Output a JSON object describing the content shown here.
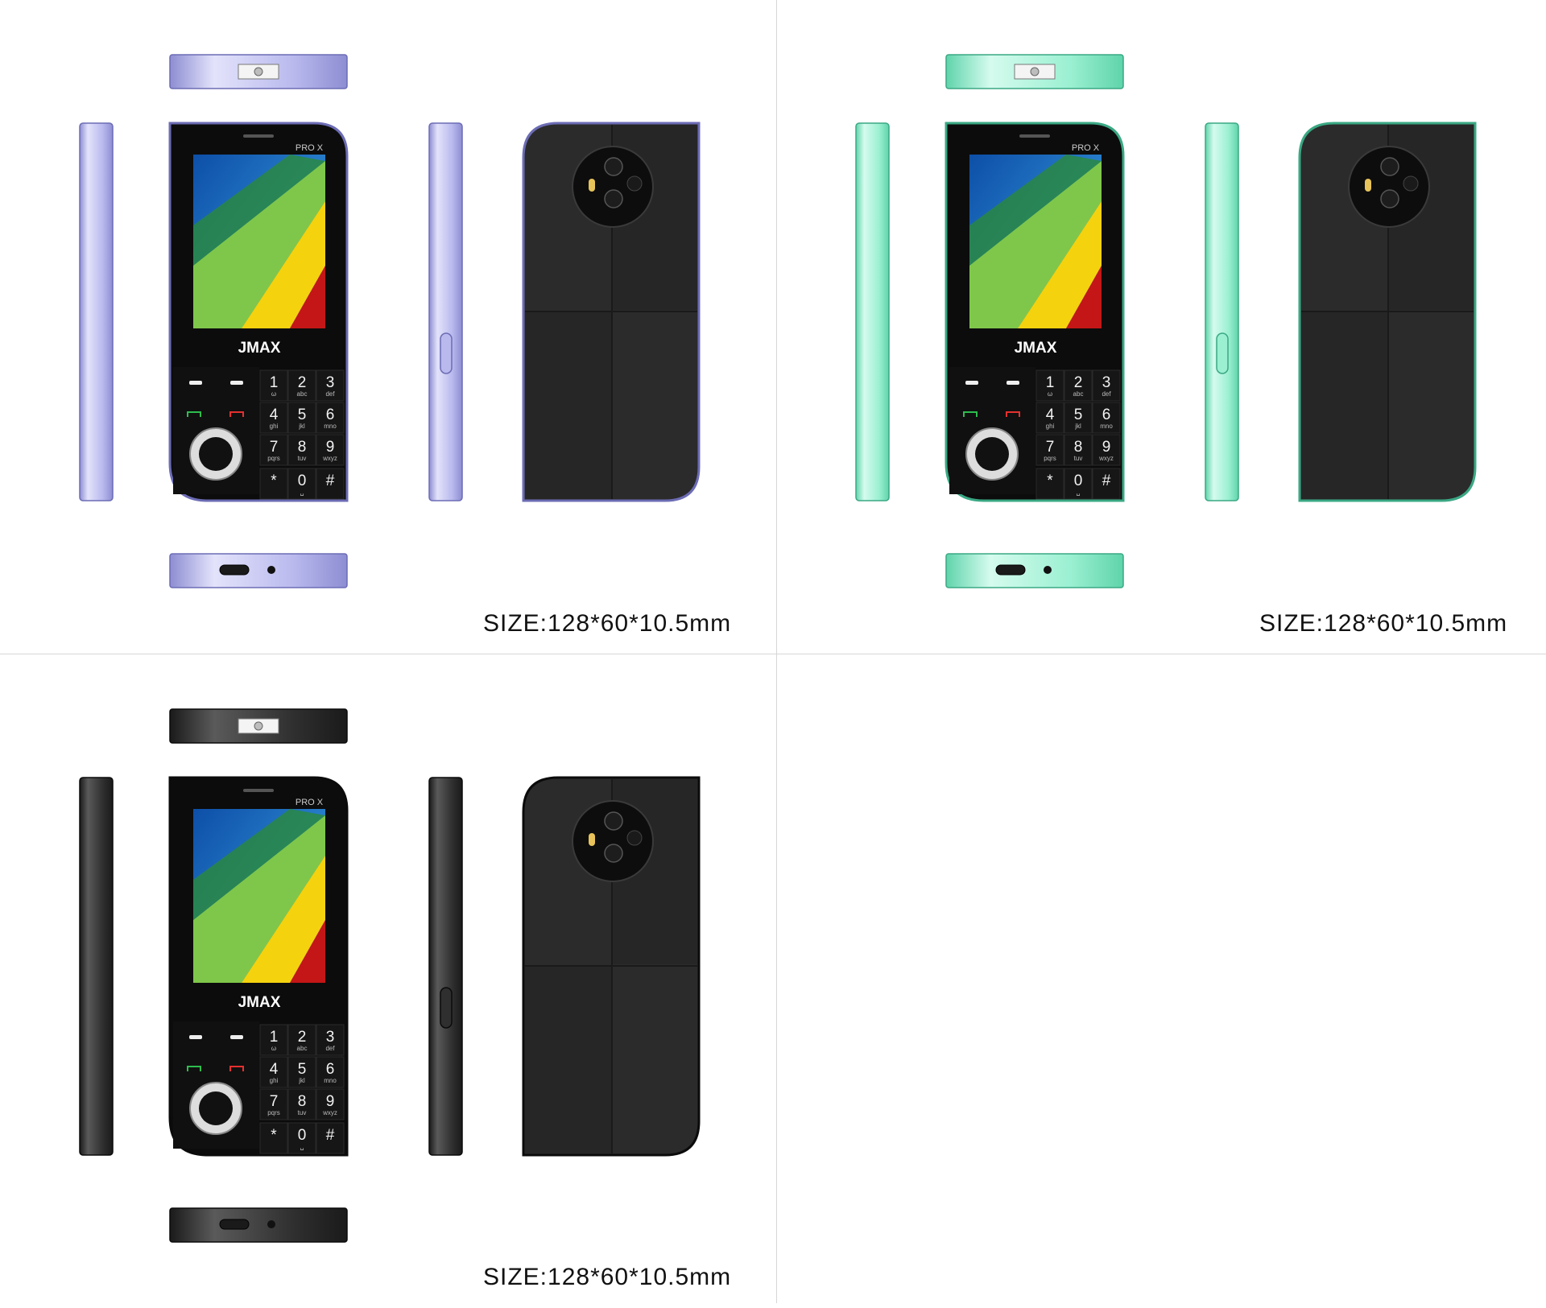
{
  "variants": [
    {
      "name": "lavender",
      "colors": {
        "light": "#e3e3fb",
        "main": "#b9b9ee",
        "dark": "#8d8dd2",
        "edge": "#6c6cb5"
      },
      "size_label": "SIZE:128*60*10.5mm"
    },
    {
      "name": "mint",
      "colors": {
        "light": "#d5fbee",
        "main": "#9bf0d2",
        "dark": "#5fd4ab",
        "edge": "#3aa884"
      },
      "size_label": "SIZE:128*60*10.5mm"
    },
    {
      "name": "black",
      "colors": {
        "light": "#5a5a5a",
        "main": "#2f2f2f",
        "dark": "#1a1a1a",
        "edge": "#0b0b0b"
      },
      "size_label": "SIZE:128*60*10.5mm"
    }
  ],
  "phone": {
    "model": "PRO X",
    "brand": "JMAX",
    "keys": [
      {
        "digit": "1",
        "sub": "ω"
      },
      {
        "digit": "2",
        "sub": "abc"
      },
      {
        "digit": "3",
        "sub": "def"
      },
      {
        "digit": "4",
        "sub": "ghi"
      },
      {
        "digit": "5",
        "sub": "jkl"
      },
      {
        "digit": "6",
        "sub": "mno"
      },
      {
        "digit": "7",
        "sub": "pqrs"
      },
      {
        "digit": "8",
        "sub": "tuv"
      },
      {
        "digit": "9",
        "sub": "wxyz"
      },
      {
        "digit": "*",
        "sub": ""
      },
      {
        "digit": "0",
        "sub": "␣"
      },
      {
        "digit": "#",
        "sub": ""
      }
    ]
  },
  "icons": [
    "soft-key-icon",
    "call-icon",
    "end-call-icon",
    "nav-ring-icon",
    "camera-module-icon",
    "flash-icon",
    "torch-icon",
    "usb-port-icon",
    "mic-hole-icon",
    "side-button-icon"
  ]
}
